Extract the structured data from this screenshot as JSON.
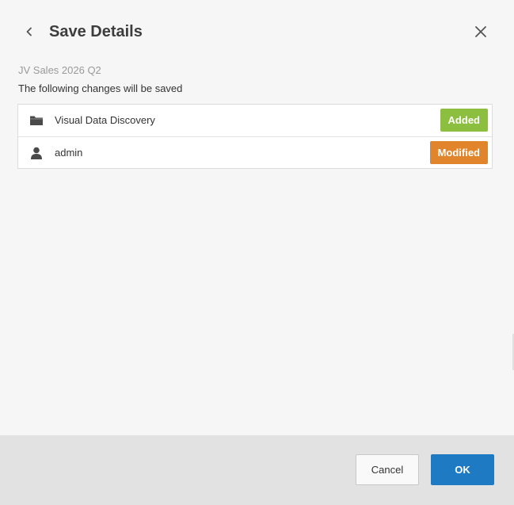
{
  "dialog": {
    "title": "Save Details",
    "subtitle": "JV Sales 2026 Q2",
    "description": "The following changes will be saved",
    "back_icon": "chevron-left-icon",
    "close_icon": "close-icon"
  },
  "changes": [
    {
      "icon": "folder-icon",
      "label": "Visual Data Discovery",
      "status": "Added",
      "status_color": "#8cbf3f"
    },
    {
      "icon": "user-icon",
      "label": "admin",
      "status": "Modified",
      "status_color": "#e0852b"
    }
  ],
  "footer": {
    "cancel_label": "Cancel",
    "ok_label": "OK"
  },
  "colors": {
    "primary": "#1f7ac4",
    "background": "#f6f6f6",
    "footer_background": "#e2e2e2"
  }
}
